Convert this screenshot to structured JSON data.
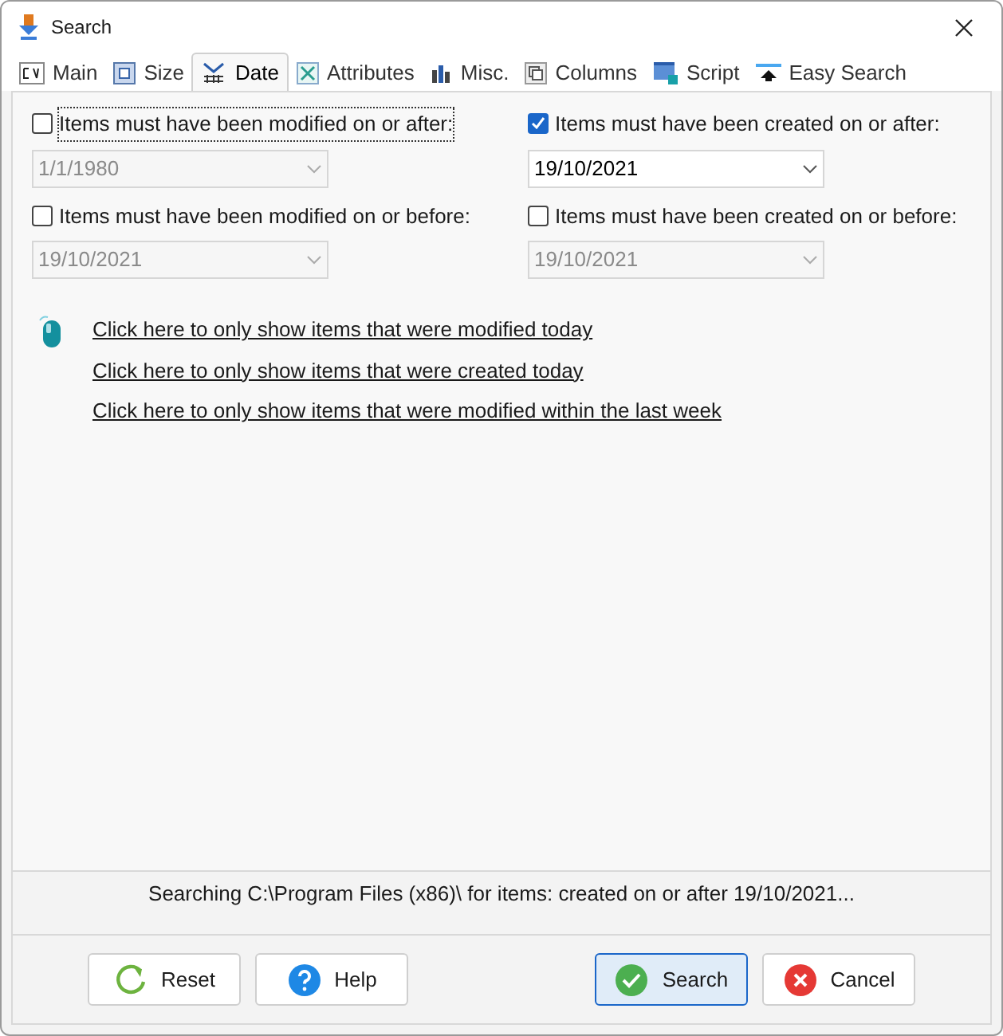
{
  "window": {
    "title": "Search"
  },
  "tabs": [
    {
      "label": "Main",
      "selected": false
    },
    {
      "label": "Size",
      "selected": false
    },
    {
      "label": "Date",
      "selected": true
    },
    {
      "label": "Attributes",
      "selected": false
    },
    {
      "label": "Misc.",
      "selected": false
    },
    {
      "label": "Columns",
      "selected": false
    },
    {
      "label": "Script",
      "selected": false
    },
    {
      "label": "Easy Search",
      "selected": false
    }
  ],
  "date_options": [
    {
      "label": "Items must have been modified on or after:",
      "checked": false,
      "focused": true,
      "value": "1/1/1980"
    },
    {
      "label": "Items must have been created on or after:",
      "checked": true,
      "focused": false,
      "value": "19/10/2021"
    },
    {
      "label": "Items must have been modified on or before:",
      "checked": false,
      "focused": false,
      "value": "19/10/2021"
    },
    {
      "label": "Items must have been created on or before:",
      "checked": false,
      "focused": false,
      "value": "19/10/2021"
    }
  ],
  "quick_links": [
    "Click here to only show items that were modified today",
    "Click here to only show items that were created today",
    "Click here to only show items that were modified within the last week"
  ],
  "status_bar": "Searching C:\\Program Files (x86)\\ for items: created on or after 19/10/2021...",
  "buttons": [
    {
      "label": "Reset",
      "default": false
    },
    {
      "label": "Help",
      "default": false
    },
    {
      "label": "Search",
      "default": true
    },
    {
      "label": "Cancel",
      "default": false
    }
  ]
}
